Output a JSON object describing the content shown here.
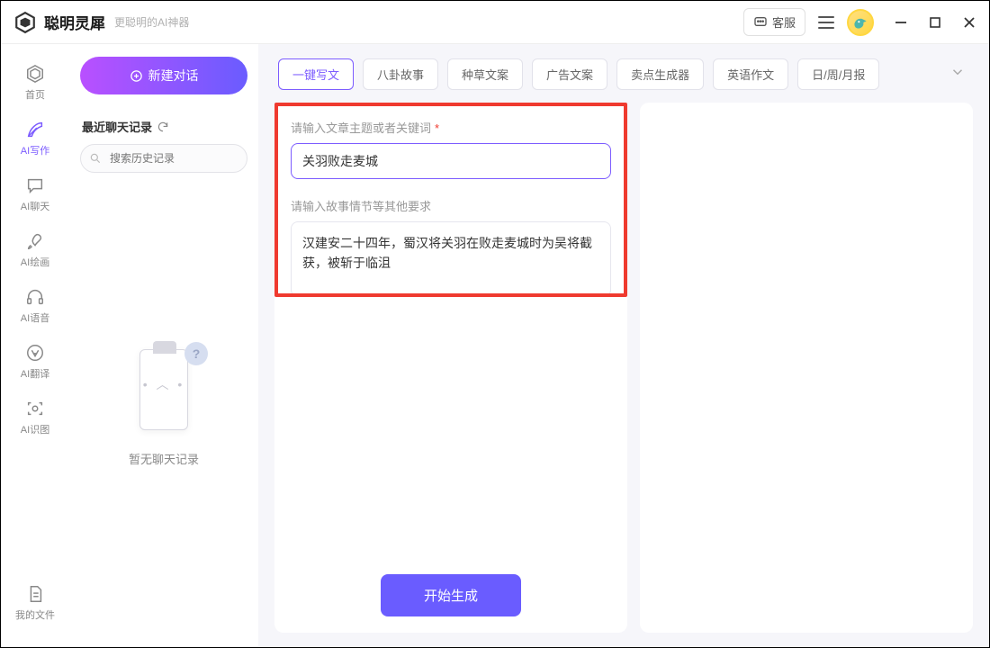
{
  "titlebar": {
    "app_name": "聪明灵犀",
    "tagline": "更聪明的AI神器",
    "service_label": "客服"
  },
  "sidebar": {
    "items": [
      {
        "label": "首页"
      },
      {
        "label": "AI写作"
      },
      {
        "label": "AI聊天"
      },
      {
        "label": "AI绘画"
      },
      {
        "label": "AI语音"
      },
      {
        "label": "AI翻译"
      },
      {
        "label": "AI识图"
      }
    ],
    "files_label": "我的文件"
  },
  "history": {
    "new_chat_label": "新建对话",
    "recent_label": "最近聊天记录",
    "search_placeholder": "搜索历史记录",
    "empty_text": "暂无聊天记录"
  },
  "categories": {
    "tabs": [
      "一键写文",
      "八卦故事",
      "种草文案",
      "广告文案",
      "卖点生成器",
      "英语作文",
      "日/周/月报"
    ],
    "active_index": 0
  },
  "form": {
    "topic_label": "请输入文章主题或者关键词",
    "topic_value": "关羽败走麦城",
    "detail_label": "请输入故事情节等其他要求",
    "detail_value": "汉建安二十四年，蜀汉将关羽在败走麦城时为吴将截获，被斩于临沮",
    "generate_label": "开始生成"
  },
  "icons": {
    "home": "home-icon",
    "writing": "feather-icon",
    "chat": "chat-icon",
    "paint": "brush-icon",
    "voice": "headphone-icon",
    "translate": "translate-icon",
    "image": "scan-icon",
    "files": "file-icon"
  }
}
